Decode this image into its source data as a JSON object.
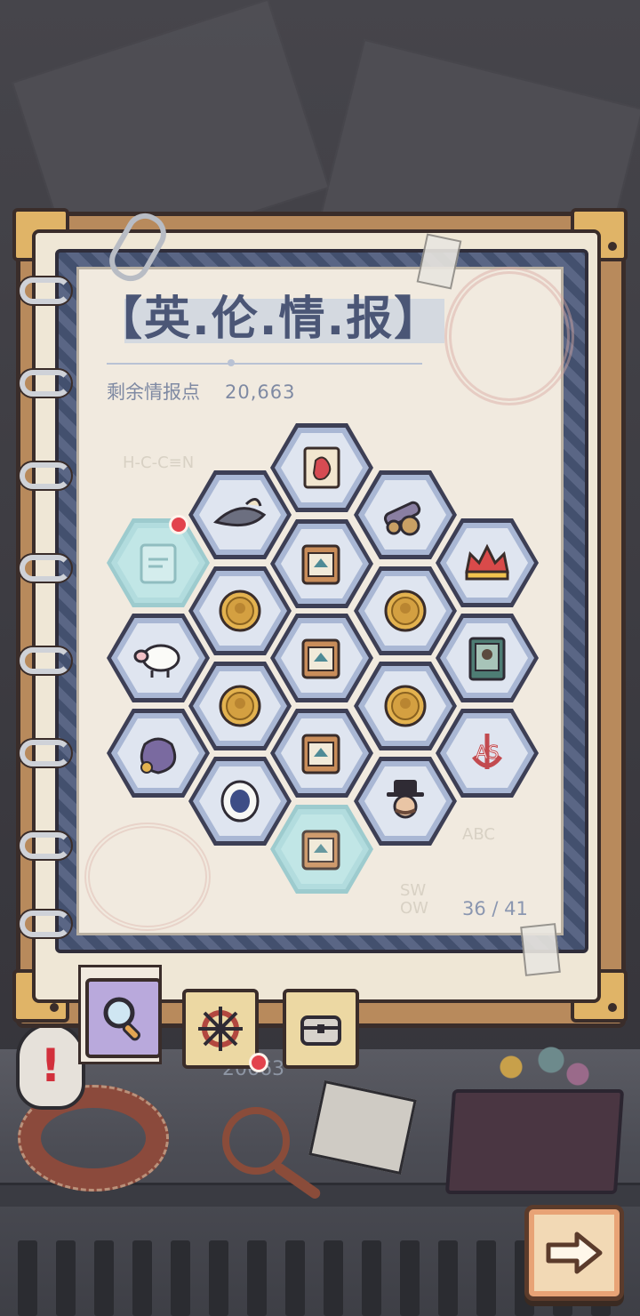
{
  "header": {
    "title": "【英.伦.情.报】",
    "points_label": "剩余情报点",
    "points_value": "20,663"
  },
  "page_indicator": "36 / 41",
  "background_counter": "20663",
  "doodles": {
    "formula": "H-C-C≡N",
    "abc": "ABC",
    "sw": "SW\nOW"
  },
  "colors": {
    "title": "#4b5676",
    "hex_border": "#3d3f55",
    "hex_unlocked": "#dfe5f0",
    "hex_locked": "#b9e5e8",
    "notification": "#e2424c",
    "tab_active": "#b9a9dc",
    "tab_normal": "#ecd8a3"
  },
  "intel_grid": [
    {
      "icon": "map-scroll-icon",
      "state": "unlocked"
    },
    {
      "icon": "bicorne-hat-icon",
      "state": "unlocked"
    },
    {
      "icon": "cannon-icon",
      "state": "unlocked"
    },
    {
      "icon": "letter-icon",
      "state": "locked",
      "badge": true
    },
    {
      "icon": "map-card-icon",
      "state": "unlocked"
    },
    {
      "icon": "crown-icon",
      "state": "unlocked"
    },
    {
      "icon": "gold-coin-icon",
      "state": "unlocked"
    },
    {
      "icon": "gold-coin-icon",
      "state": "unlocked"
    },
    {
      "icon": "sheep-icon",
      "state": "unlocked"
    },
    {
      "icon": "map-card-icon",
      "state": "unlocked"
    },
    {
      "icon": "portrait-cards-icon",
      "state": "unlocked"
    },
    {
      "icon": "gold-coin-icon",
      "state": "unlocked"
    },
    {
      "icon": "gold-coin-icon",
      "state": "unlocked"
    },
    {
      "icon": "coin-sack-icon",
      "state": "unlocked"
    },
    {
      "icon": "map-card-icon",
      "state": "unlocked"
    },
    {
      "icon": "anchor-emblem-icon",
      "state": "unlocked"
    },
    {
      "icon": "fur-cloak-icon",
      "state": "unlocked"
    },
    {
      "icon": "gentleman-icon",
      "state": "unlocked"
    },
    {
      "icon": "map-card-icon",
      "state": "locked"
    }
  ],
  "tabs": [
    {
      "icon": "magnifier-icon",
      "active": true
    },
    {
      "icon": "ship-wheel-icon",
      "active": false,
      "badge": true
    },
    {
      "icon": "chest-icon",
      "active": false
    }
  ],
  "next_button_icon": "arrow-right-icon"
}
